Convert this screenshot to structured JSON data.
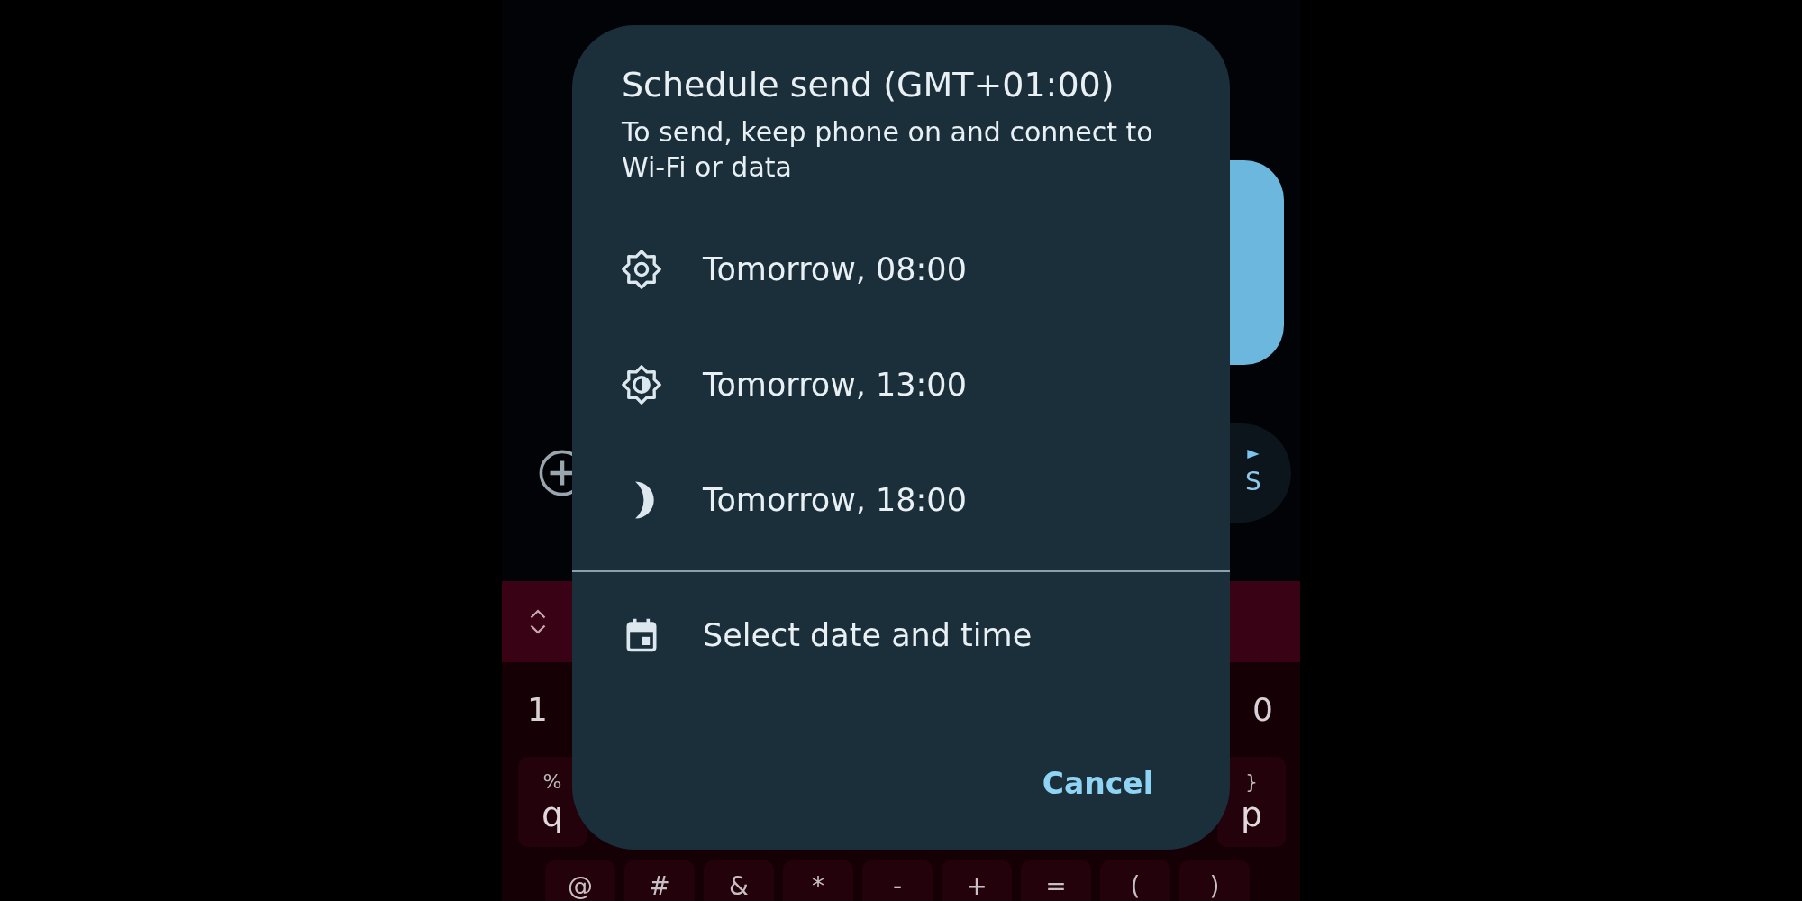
{
  "dialog": {
    "title": "Schedule send (GMT+01:00)",
    "subtitle": "To send, keep phone on and connect to Wi-Fi or data",
    "options": [
      {
        "kind": "sun",
        "label": "Tomorrow, 08:00"
      },
      {
        "kind": "half-sun",
        "label": "Tomorrow, 13:00"
      },
      {
        "kind": "moon",
        "label": "Tomorrow, 18:00"
      }
    ],
    "custom_option": {
      "label": "Select date and time"
    },
    "cancel_button": "Cancel"
  },
  "background": {
    "send_button_label": "S",
    "keyboard": {
      "number_row": [
        "1",
        "0"
      ],
      "letter_row": [
        {
          "symbol": "%",
          "letter": "q"
        },
        {
          "symbol": "}",
          "letter": "p"
        }
      ],
      "symbol_row": [
        "@",
        "#",
        "&",
        "*",
        "-",
        "+",
        "=",
        "(",
        ")"
      ]
    }
  }
}
